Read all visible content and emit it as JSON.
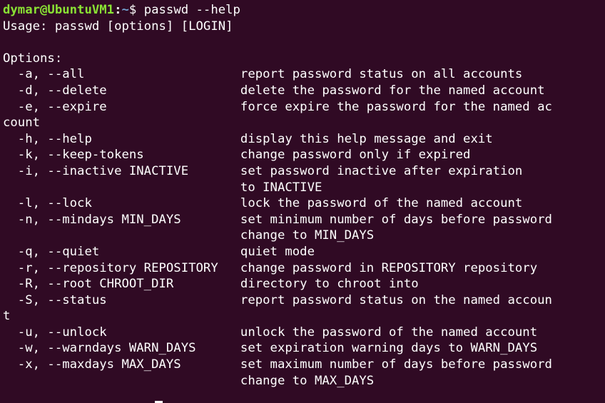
{
  "prompt": {
    "user_host": "dymar@UbuntuVM1",
    "separator": ":",
    "path": "~",
    "symbol": "$ ",
    "command": "passwd --help"
  },
  "output_lines": [
    "Usage: passwd [options] [LOGIN]",
    "",
    "Options:",
    "  -a, --all                     report password status on all accounts",
    "  -d, --delete                  delete the password for the named account",
    "  -e, --expire                  force expire the password for the named ac",
    "count",
    "  -h, --help                    display this help message and exit",
    "  -k, --keep-tokens             change password only if expired",
    "  -i, --inactive INACTIVE       set password inactive after expiration",
    "                                to INACTIVE",
    "  -l, --lock                    lock the password of the named account",
    "  -n, --mindays MIN_DAYS        set minimum number of days before password",
    "                                change to MIN_DAYS",
    "  -q, --quiet                   quiet mode",
    "  -r, --repository REPOSITORY   change password in REPOSITORY repository",
    "  -R, --root CHROOT_DIR         directory to chroot into",
    "  -S, --status                  report password status on the named accoun",
    "t",
    "  -u, --unlock                  unlock the password of the named account",
    "  -w, --warndays WARN_DAYS      set expiration warning days to WARN_DAYS",
    "  -x, --maxdays MAX_DAYS        set maximum number of days before password",
    "                                change to MAX_DAYS"
  ],
  "colors": {
    "background": "#300a24",
    "text": "#ffffff",
    "prompt_user": "#8ae234",
    "prompt_path": "#729fcf"
  }
}
